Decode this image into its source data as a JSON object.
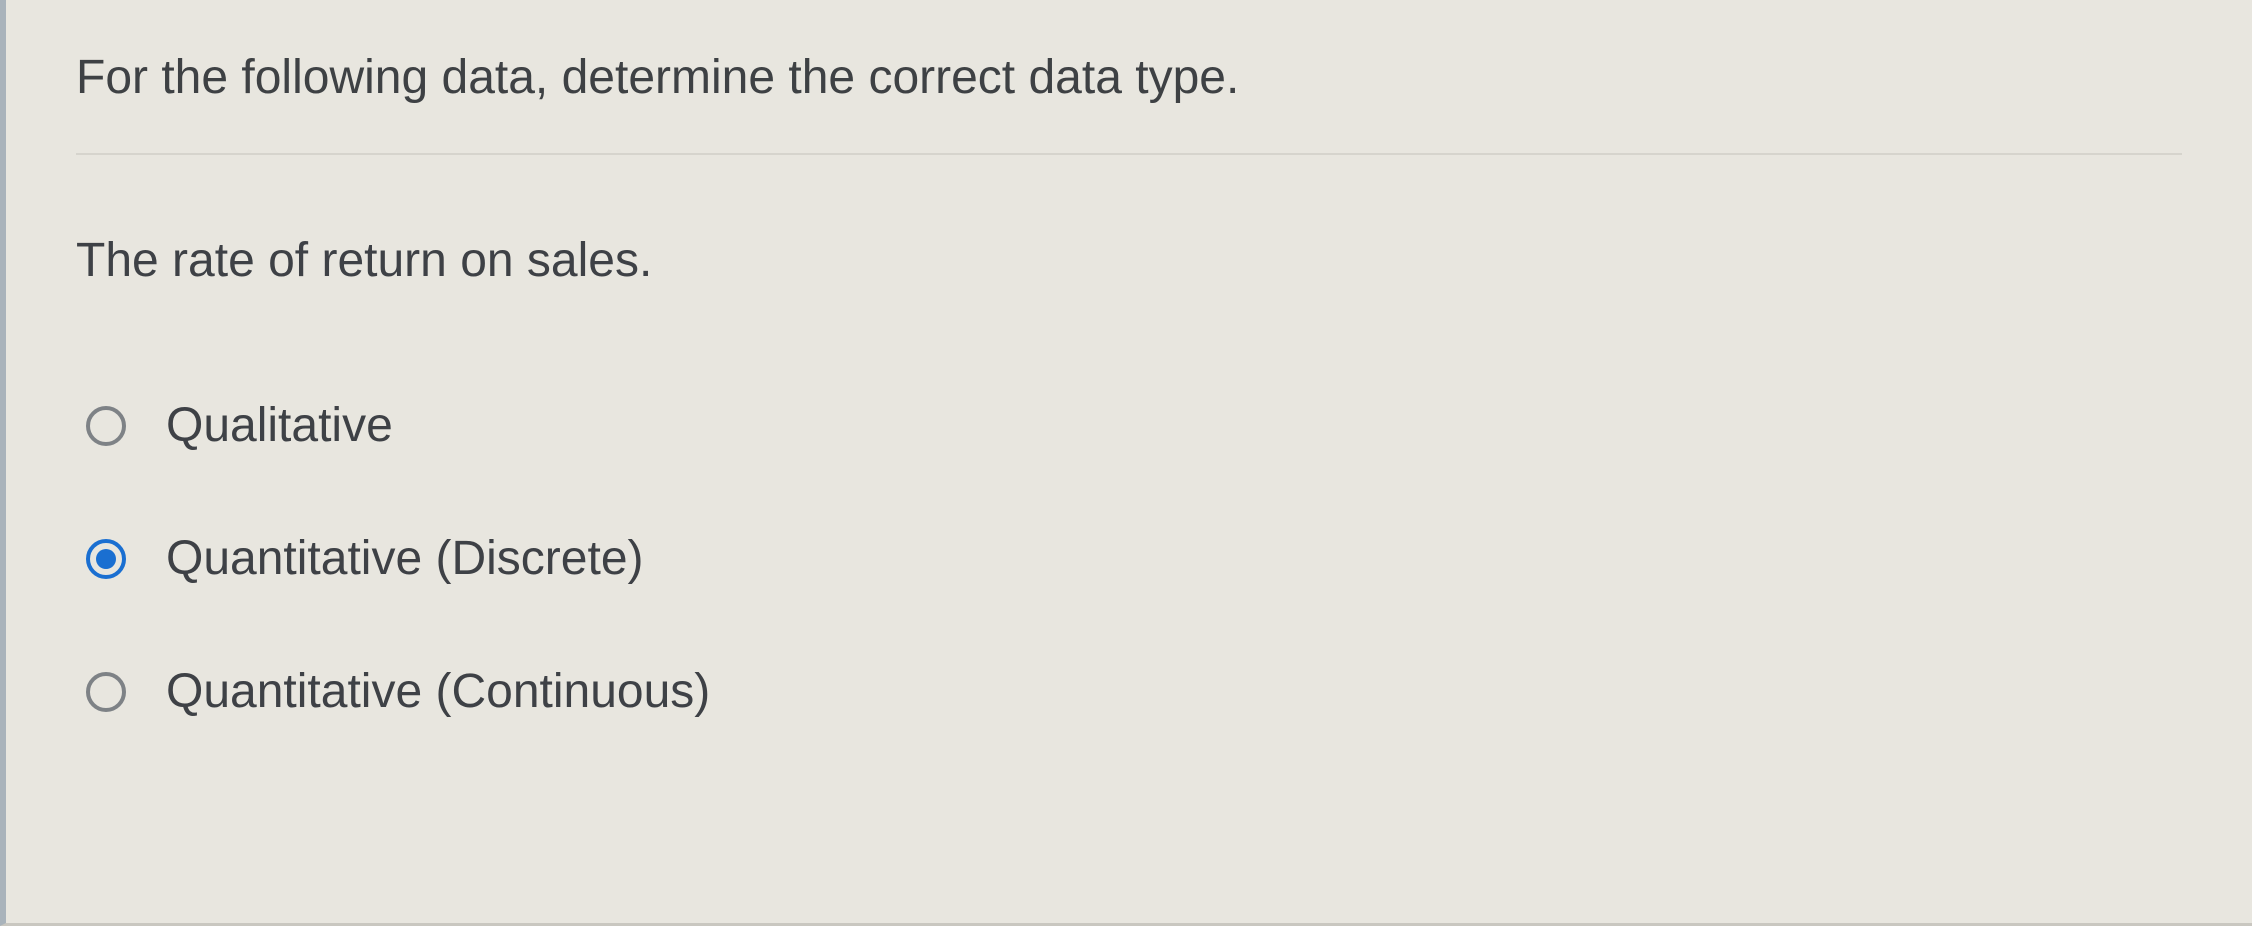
{
  "question": {
    "prompt": "For the following data, determine the correct data type.",
    "text": "The rate of return on sales.",
    "options": [
      {
        "label": "Qualitative",
        "selected": false
      },
      {
        "label": "Quantitative (Discrete)",
        "selected": true
      },
      {
        "label": "Quantitative (Continuous)",
        "selected": false
      }
    ]
  }
}
